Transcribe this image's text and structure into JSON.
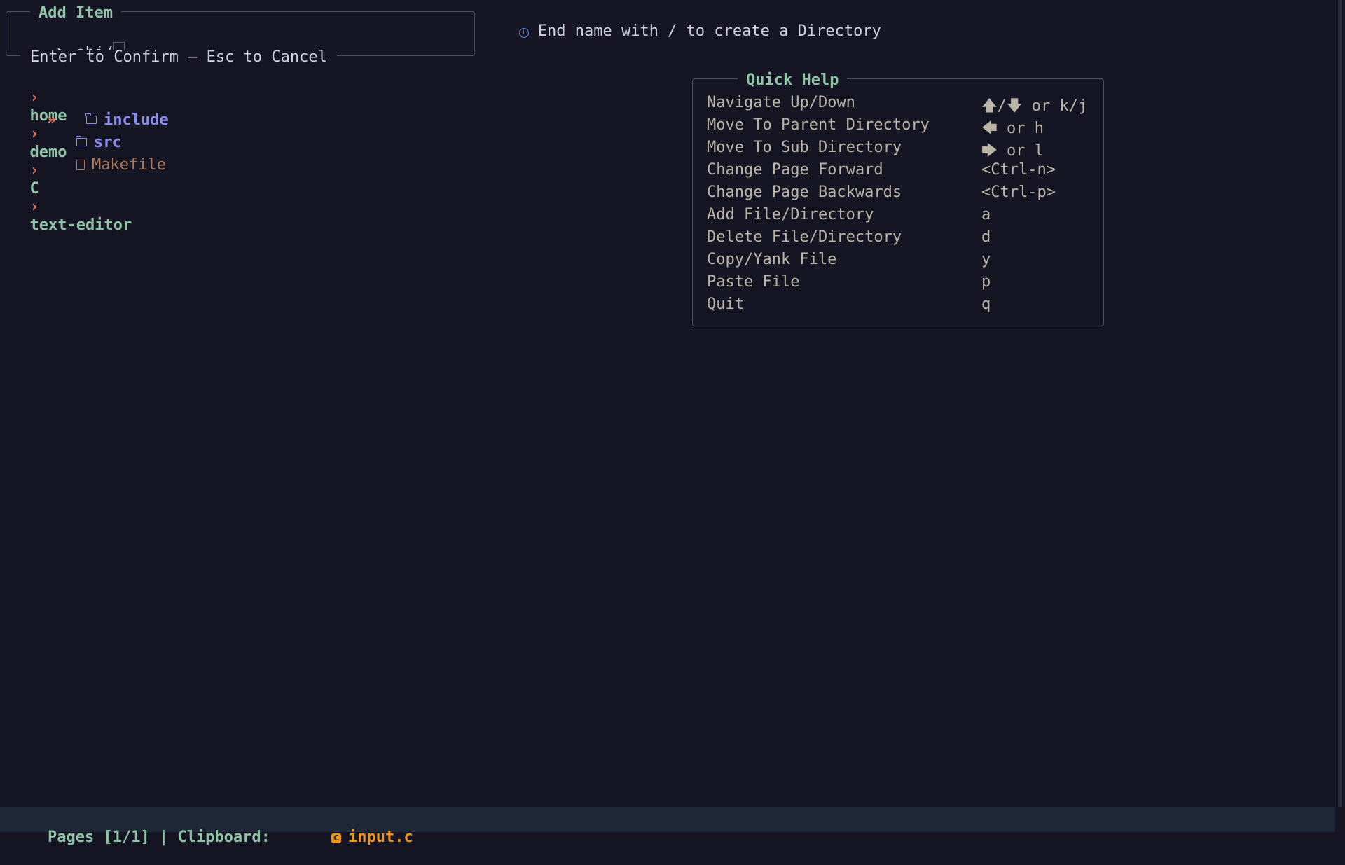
{
  "add_item": {
    "title": "Add Item",
    "prompt": ">",
    "value": "obj/",
    "footer": "Enter to Confirm — Esc to Cancel"
  },
  "info": {
    "message": "End name with / to create a Directory"
  },
  "breadcrumb": {
    "separator": "›",
    "parts": [
      "home",
      "demo",
      "C",
      "text-editor"
    ]
  },
  "file_list": {
    "selection_marker": "»",
    "items": [
      {
        "name": "include",
        "type": "directory",
        "selected": true
      },
      {
        "name": "src",
        "type": "directory",
        "selected": false
      },
      {
        "name": "Makefile",
        "type": "file",
        "selected": false
      }
    ]
  },
  "quick_help": {
    "title": "Quick Help",
    "rows": [
      {
        "action": "Navigate Up/Down",
        "key": "🡅/🡇 or k/j"
      },
      {
        "action": "Move To Parent Directory",
        "key": "🡄 or h"
      },
      {
        "action": "Move To Sub Directory",
        "key": "🡆 or l"
      },
      {
        "action": "Change Page Forward",
        "key": "<Ctrl-n>"
      },
      {
        "action": "Change Page Backwards",
        "key": "<Ctrl-p>"
      },
      {
        "action": "Add File/Directory",
        "key": "a"
      },
      {
        "action": "Delete File/Directory",
        "key": "d"
      },
      {
        "action": "Copy/Yank File",
        "key": "y"
      },
      {
        "action": "Paste File",
        "key": "p"
      },
      {
        "action": "Quit",
        "key": "q"
      }
    ]
  },
  "status_bar": {
    "pages": "Pages [1/1]",
    "divider": "|",
    "clipboard_label": "Clipboard:",
    "clipboard_icon": "C",
    "clipboard_file": "input.c"
  },
  "colors": {
    "background": "#161524",
    "accent_green": "#8fc4a6",
    "accent_red": "#e8705a",
    "directory": "#8a8cf0",
    "file": "#a97a5e",
    "clipboard": "#f0941a"
  }
}
